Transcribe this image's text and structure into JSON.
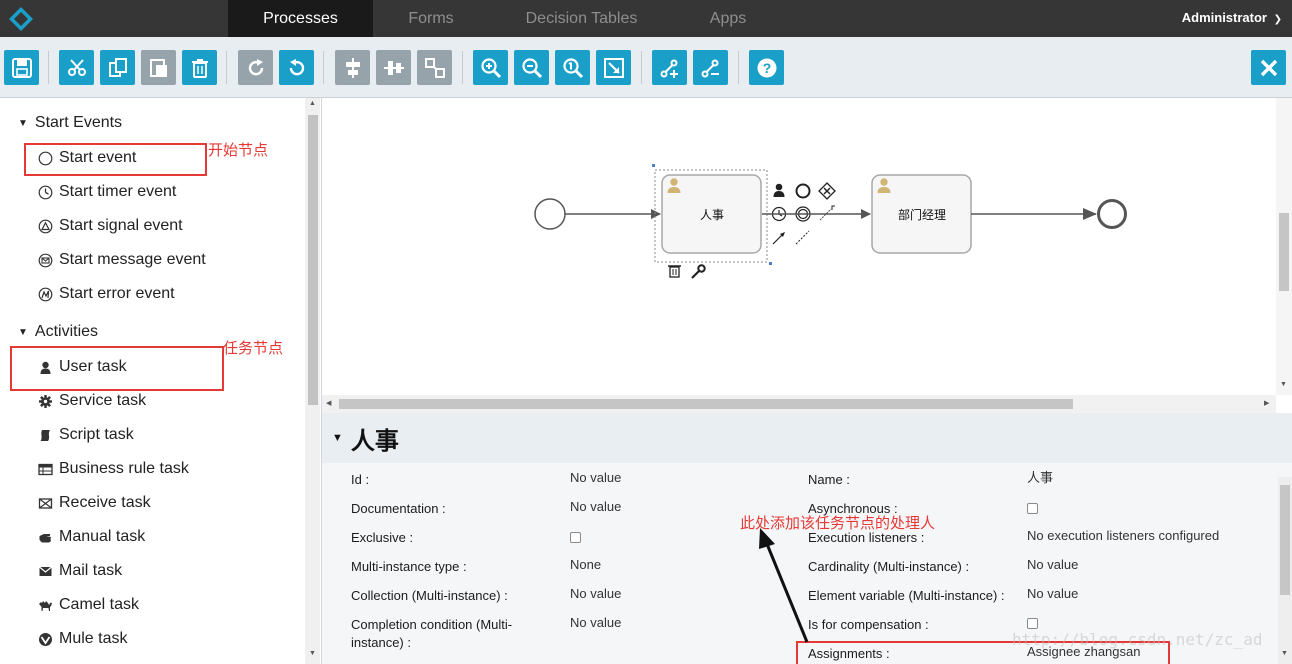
{
  "nav": {
    "tabs": [
      "Processes",
      "Forms",
      "Decision Tables",
      "Apps"
    ],
    "active_tab": "Processes",
    "user": "Administrator"
  },
  "toolbar": {
    "buttons": [
      "save-icon",
      "cut-icon",
      "copy-icon",
      "paste-icon",
      "delete-icon",
      "redo-icon",
      "undo-icon",
      "align-vertical-icon",
      "align-horizontal-icon",
      "same-size-icon",
      "zoom-in-icon",
      "zoom-out-icon",
      "zoom-actual-icon",
      "zoom-fit-icon",
      "bendpoint-add-icon",
      "bendpoint-remove-icon",
      "help-icon",
      "close-icon"
    ]
  },
  "palette": {
    "groups": [
      {
        "label": "Start Events",
        "items": [
          "Start event",
          "Start timer event",
          "Start signal event",
          "Start message event",
          "Start error event"
        ]
      },
      {
        "label": "Activities",
        "items": [
          "User task",
          "Service task",
          "Script task",
          "Business rule task",
          "Receive task",
          "Manual task",
          "Mail task",
          "Camel task",
          "Mule task"
        ]
      }
    ]
  },
  "annotations": {
    "start_node": "开始节点",
    "task_node": "任务节点",
    "assignee_hint": "此处添加该任务节点的处理人"
  },
  "diagram": {
    "task1": "人事",
    "task2": "部门经理"
  },
  "properties": {
    "title": "人事",
    "left": [
      {
        "label": "Id :",
        "value": "No value"
      },
      {
        "label": "Documentation :",
        "value": "No value"
      },
      {
        "label": "Exclusive :",
        "value": ""
      },
      {
        "label": "Multi-instance type :",
        "value": "None"
      },
      {
        "label": "Collection (Multi-instance) :",
        "value": "No value"
      },
      {
        "label": "Completion condition (Multi-instance) :",
        "value": "No value"
      }
    ],
    "right": [
      {
        "label": "Name :",
        "value": "人事"
      },
      {
        "label": "Asynchronous :",
        "value": ""
      },
      {
        "label": "Execution listeners :",
        "value": "No execution listeners configured"
      },
      {
        "label": "Cardinality (Multi-instance) :",
        "value": "No value"
      },
      {
        "label": "Element variable (Multi-instance) :",
        "value": "No value"
      },
      {
        "label": "Is for compensation :",
        "value": ""
      },
      {
        "label": "Assignments :",
        "value": "Assignee zhangsan"
      }
    ]
  },
  "watermark": "http://blog.csdn.net/zc_ad",
  "colors": {
    "nav_bg": "#363636",
    "toolbar_blue": "#1a9fc9",
    "toolbar_grey": "#97a3ab",
    "annotation_red": "#e53935",
    "task_fill": "#f6f6f6",
    "user_icon": "#d1b574"
  }
}
